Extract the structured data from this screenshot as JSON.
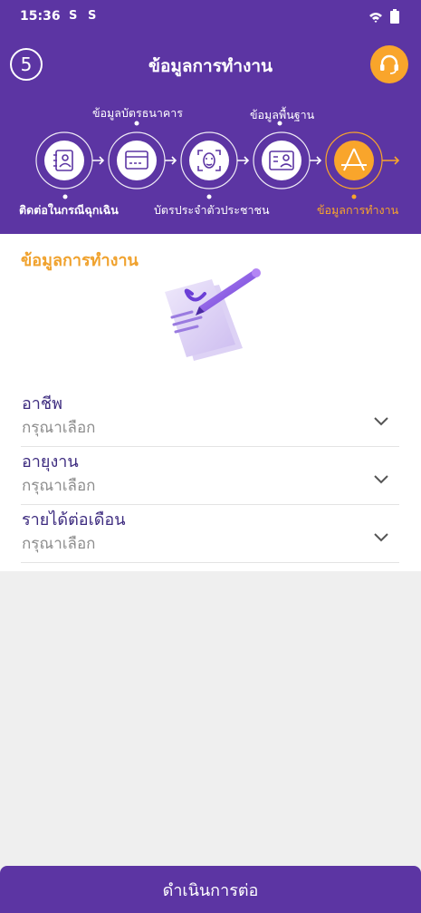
{
  "status_bar": {
    "time": "15:36",
    "icon1": "S",
    "icon2": "S"
  },
  "header": {
    "step_number": "5",
    "title": "ข้อมูลการทำงาน",
    "support_icon": "headset-icon"
  },
  "stepper": {
    "steps": [
      {
        "label": "ติดต่อในกรณีฉุกเฉิน",
        "icon": "contact-book-icon"
      },
      {
        "label": "ข้อมูลบัตรธนาคาร",
        "icon": "credit-card-icon"
      },
      {
        "label": "บัตรประจำตัวประชาชน",
        "icon": "face-scan-icon"
      },
      {
        "label": "ข้อมูลพื้นฐาน",
        "icon": "id-card-icon"
      },
      {
        "label": "ข้อมูลการทำงาน",
        "icon": "work-icon"
      }
    ],
    "active_color": "#f9a52b"
  },
  "section": {
    "title": "ข้อมูลการทำงาน"
  },
  "form": {
    "fields": [
      {
        "label": "อาชีพ",
        "value": "กรุณาเลือก"
      },
      {
        "label": "อายุงาน",
        "value": "กรุณาเลือก"
      },
      {
        "label": "รายได้ต่อเดือน",
        "value": "กรุณาเลือก"
      }
    ]
  },
  "footer": {
    "button_label": "ดำเนินการต่อ"
  },
  "colors": {
    "primary": "#5c35a3",
    "accent": "#f9a52b",
    "label": "#3d2b7f"
  }
}
